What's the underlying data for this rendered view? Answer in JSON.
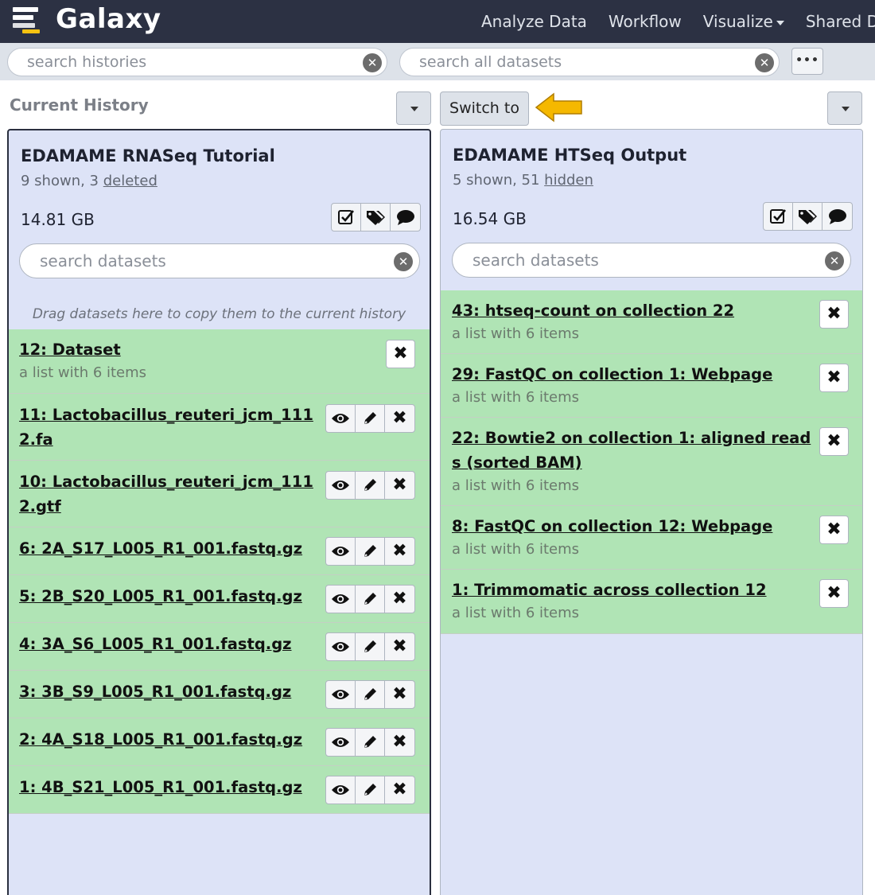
{
  "navbar": {
    "brand": "Galaxy",
    "items": [
      "Analyze Data",
      "Workflow",
      "Visualize",
      "Shared D"
    ]
  },
  "search": {
    "histories_placeholder": "search histories",
    "all_datasets_placeholder": "search all datasets",
    "more_label": "•••"
  },
  "header": {
    "current_history_label": "Current History",
    "switch_label": "Switch to"
  },
  "left_history": {
    "name": "EDAMAME RNASeq Tutorial",
    "shown_text": "9 shown, 3 ",
    "extra_link": "deleted",
    "size": "14.81 GB",
    "search_placeholder": "search datasets",
    "drag_message": "Drag datasets here to copy them to the current history",
    "datasets": [
      {
        "title": "12: Dataset",
        "subtitle": "a list with 6 items"
      },
      {
        "title": "11: Lactobacillus_reuteri_jcm_111 2.fa",
        "line1": "11: Lactobacillus_reuteri_jcm_111",
        "line2": "2.fa "
      },
      {
        "title": "10: Lactobacillus_reuteri_jcm_111 2.gtf",
        "line1": "10: Lactobacillus_reuteri_jcm_111",
        "line2": "2.gtf "
      },
      {
        "title": "6: 2A_S17_L005_R1_001.fastq.gz "
      },
      {
        "title": "5: 2B_S20_L005_R1_001.fastq.gz "
      },
      {
        "title": "4: 3A_S6_L005_R1_001.fastq.gz "
      },
      {
        "title": "3: 3B_S9_L005_R1_001.fastq.gz "
      },
      {
        "title": "2: 4A_S18_L005_R1_001.fastq.gz "
      },
      {
        "title": "1: 4B_S21_L005_R1_001.fastq.gz "
      }
    ]
  },
  "right_history": {
    "name": "EDAMAME HTSeq Output",
    "shown_text": "5 shown, 51 ",
    "extra_link": "hidden",
    "size": "16.54 GB",
    "search_placeholder": "search datasets",
    "datasets": [
      {
        "title": "43: htseq-count on collection 22",
        "subtitle": "a list with 6 items"
      },
      {
        "title": "29: FastQC on collection 1: Webpage",
        "subtitle": "a list with 6 items"
      },
      {
        "line1": "22: Bowtie2 on collection 1: aligned read",
        "line2": "s (sorted BAM)",
        "subtitle": "a list with 6 items"
      },
      {
        "title": "8: FastQC on collection 12: Webpage",
        "subtitle": "a list with 6 items"
      },
      {
        "title": "1: Trimmomatic across collection 12",
        "subtitle": "a list with 6 items"
      }
    ]
  },
  "colors": {
    "navbar": "#2c3143",
    "panel_bg": "#dde3f7",
    "dataset_ok": "#b0e4b5",
    "annotation_arrow": "#f5b800"
  }
}
